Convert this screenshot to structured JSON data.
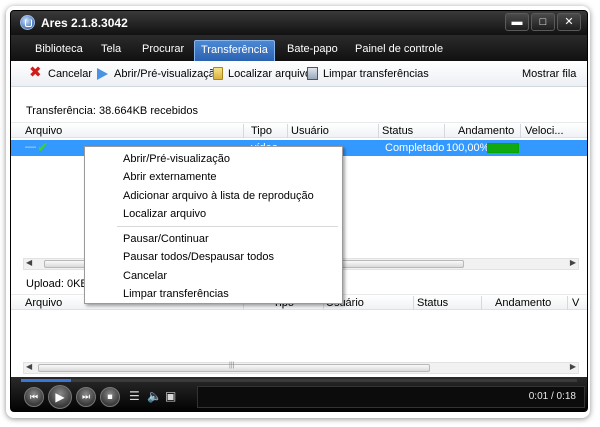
{
  "window": {
    "title": "Ares 2.1.8.3042"
  },
  "window_controls": {
    "minimize": "▬",
    "maximize": "□",
    "close": "✕"
  },
  "tabs": [
    {
      "label": "Biblioteca"
    },
    {
      "label": "Tela"
    },
    {
      "label": "Procurar"
    },
    {
      "label": "Transferência",
      "active": true
    },
    {
      "label": "Bate-papo"
    },
    {
      "label": "Painel de controle"
    }
  ],
  "toolbar": {
    "cancel": "Cancelar",
    "open_preview": "Abrir/Pré-visualização",
    "locate": "Localizar arquivo",
    "clear": "Limpar transferências",
    "show_queue": "Mostrar fila"
  },
  "transfer_status": "Transferência: 38.664KB recebidos",
  "download_columns": [
    "Arquivo",
    "Tipo",
    "Usuário",
    "Status",
    "Andamento",
    "Veloci..."
  ],
  "download_row": {
    "type": "vídeo",
    "status": "Completado",
    "progress_text": "100,00%",
    "progress_fraction": 1.0
  },
  "upload_status": "Upload: 0KB en",
  "upload_columns": [
    "Arquivo",
    "Tipo",
    "Usuário",
    "Status",
    "Andamento",
    "V"
  ],
  "context_menu": {
    "items": [
      "Abrir/Pré-visualização",
      "Abrir externamente",
      "Adicionar arquivo à lista de reprodução",
      "Localizar arquivo",
      "Pausar/Continuar",
      "Pausar todos/Despausar todos",
      "Cancelar",
      "Limpar transferências"
    ]
  },
  "player": {
    "time": "0:01 / 0:18",
    "seek_fraction": 0.09
  },
  "colors": {
    "selection": "#3399ff",
    "active_tab": "#3a74c4",
    "progress": "#12a812"
  }
}
